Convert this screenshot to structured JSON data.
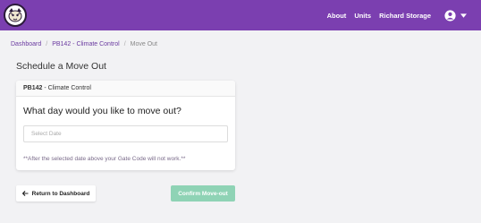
{
  "header": {
    "nav": [
      "About",
      "Units",
      "Richard Storage"
    ],
    "bg_color": "#7b3fb0",
    "logo_icon": "tiger-mascot-logo",
    "user_icon": "user-circle-icon",
    "menu_icon": "caret-down-icon"
  },
  "breadcrumb": {
    "items": [
      "Dashboard",
      "PB142 - Climate Control",
      "Move Out"
    ],
    "separator": "/"
  },
  "page": {
    "title": "Schedule a Move Out"
  },
  "card": {
    "unit_code": "PB142",
    "unit_desc": "- Climate Control",
    "question": "What day would you like to move out?",
    "date_placeholder": "Select Date",
    "date_value": "",
    "note": "**After the selected date above your Gate Code will not work.**"
  },
  "actions": {
    "return_label": "Return to Dashboard",
    "confirm_label": "Confirm Move-out",
    "confirm_color": "#8fd3b5",
    "return_icon": "arrow-left-icon"
  }
}
